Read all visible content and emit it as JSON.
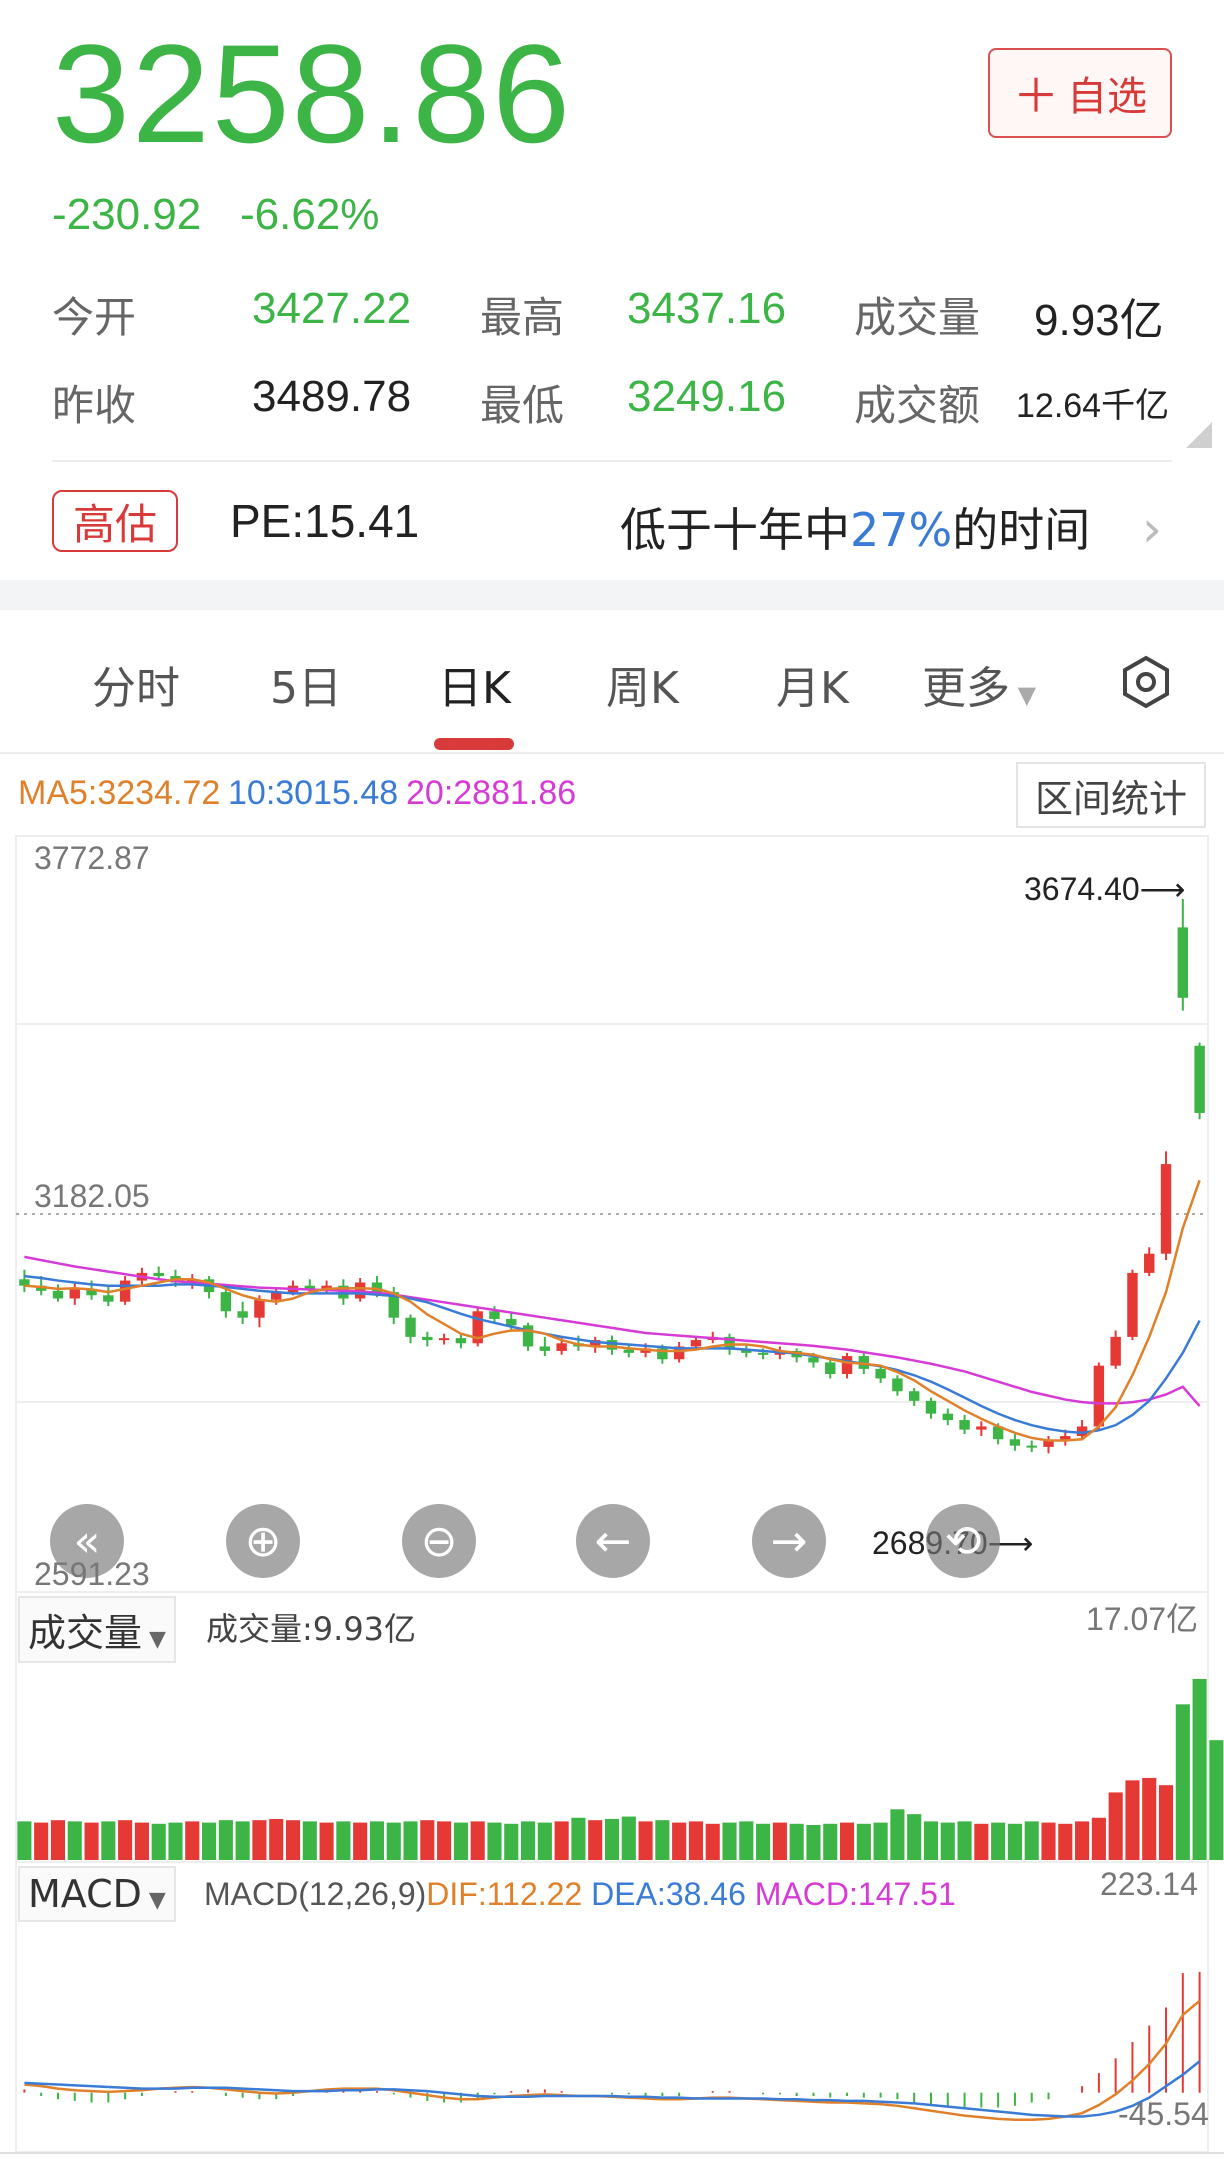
{
  "header": {
    "price": "3258.86",
    "change_abs": "-230.92",
    "change_pct": "-6.62%",
    "fav_button": "自选"
  },
  "quotes": {
    "open_label": "今开",
    "open_value": "3427.22",
    "high_label": "最高",
    "high_value": "3437.16",
    "volume_label": "成交量",
    "volume_value": "9.93亿",
    "prev_close_label": "昨收",
    "prev_close_value": "3489.78",
    "low_label": "最低",
    "low_value": "3249.16",
    "amount_label": "成交额",
    "amount_value": "12.64千亿"
  },
  "valuation": {
    "badge": "高估",
    "pe": "PE:15.41",
    "desc_prefix": "低于十年中",
    "desc_pct": "27%",
    "desc_suffix": "的时间"
  },
  "tabs": [
    {
      "label": "分时",
      "active": false
    },
    {
      "label": "5日",
      "active": false
    },
    {
      "label": "日K",
      "active": true
    },
    {
      "label": "周K",
      "active": false
    },
    {
      "label": "月K",
      "active": false
    },
    {
      "label": "更多",
      "active": false
    }
  ],
  "ma": {
    "ma5": "MA5:3234.72",
    "ma10": "10:3015.48",
    "ma20": "20:2881.86",
    "stat_button": "区间统计"
  },
  "colors": {
    "up": "#e53935",
    "down": "#3cb446",
    "ma5": "#e0802a",
    "ma10": "#3a7bd5",
    "ma20": "#d63bd6"
  },
  "kline": {
    "y_top": "3772.87",
    "y_mid": "3182.05",
    "y_bottom": "2591.23",
    "high_mark": "3674.40",
    "low_mark": "2689.70"
  },
  "volume": {
    "selector": "成交量",
    "label": "成交量:9.93亿",
    "max": "17.07亿"
  },
  "macd": {
    "selector": "MACD",
    "params": "MACD(12,26,9)",
    "dif": "DIF:112.22",
    "dea": "DEA:38.46",
    "macd": "MACD:147.51",
    "max": "223.14",
    "min": "-45.54"
  },
  "controls": [
    "fast-back-icon",
    "zoom-in-icon",
    "zoom-out-icon",
    "arrow-left-icon",
    "arrow-right-icon",
    "reset-icon"
  ],
  "chart_data": {
    "type": "candlestick",
    "ylim": [
      2591.23,
      3772.87
    ],
    "candles": [
      [
        3080,
        3070,
        3095,
        3060
      ],
      [
        3070,
        3062,
        3085,
        3055
      ],
      [
        3062,
        3050,
        3072,
        3045
      ],
      [
        3050,
        3065,
        3075,
        3040
      ],
      [
        3065,
        3055,
        3078,
        3048
      ],
      [
        3055,
        3045,
        3068,
        3038
      ],
      [
        3045,
        3078,
        3085,
        3040
      ],
      [
        3078,
        3090,
        3098,
        3070
      ],
      [
        3090,
        3085,
        3100,
        3078
      ],
      [
        3085,
        3075,
        3095,
        3068
      ],
      [
        3075,
        3080,
        3088,
        3065
      ],
      [
        3080,
        3060,
        3085,
        3050
      ],
      [
        3060,
        3030,
        3068,
        3020
      ],
      [
        3030,
        3020,
        3045,
        3010
      ],
      [
        3020,
        3048,
        3055,
        3005
      ],
      [
        3048,
        3060,
        3068,
        3040
      ],
      [
        3060,
        3070,
        3078,
        3055
      ],
      [
        3070,
        3065,
        3080,
        3058
      ],
      [
        3065,
        3070,
        3078,
        3058
      ],
      [
        3070,
        3050,
        3080,
        3040
      ],
      [
        3050,
        3075,
        3082,
        3045
      ],
      [
        3075,
        3060,
        3085,
        3052
      ],
      [
        3060,
        3020,
        3068,
        3010
      ],
      [
        3020,
        2990,
        3025,
        2980
      ],
      [
        2990,
        2985,
        2998,
        2975
      ],
      [
        2985,
        2988,
        2995,
        2978
      ],
      [
        2988,
        2980,
        2996,
        2972
      ],
      [
        2980,
        3030,
        3035,
        2975
      ],
      [
        3030,
        3018,
        3038,
        3010
      ],
      [
        3018,
        3008,
        3028,
        2998
      ],
      [
        3008,
        2975,
        3012,
        2968
      ],
      [
        2975,
        2968,
        2990,
        2960
      ],
      [
        2968,
        2980,
        2988,
        2962
      ],
      [
        2980,
        2975,
        2992,
        2968
      ],
      [
        2975,
        2985,
        2990,
        2965
      ],
      [
        2985,
        2970,
        2992,
        2962
      ],
      [
        2970,
        2965,
        2978,
        2958
      ],
      [
        2965,
        2972,
        2980,
        2958
      ],
      [
        2972,
        2955,
        2978,
        2948
      ],
      [
        2955,
        2975,
        2982,
        2950
      ],
      [
        2975,
        2985,
        2992,
        2970
      ],
      [
        2985,
        2990,
        2998,
        2980
      ],
      [
        2990,
        2970,
        2995,
        2962
      ],
      [
        2970,
        2965,
        2978,
        2958
      ],
      [
        2965,
        2962,
        2972,
        2955
      ],
      [
        2962,
        2968,
        2975,
        2955
      ],
      [
        2968,
        2958,
        2972,
        2950
      ],
      [
        2958,
        2950,
        2965,
        2942
      ],
      [
        2950,
        2932,
        2955,
        2925
      ],
      [
        2932,
        2960,
        2965,
        2925
      ],
      [
        2960,
        2940,
        2965,
        2932
      ],
      [
        2940,
        2925,
        2945,
        2918
      ],
      [
        2925,
        2905,
        2930,
        2898
      ],
      [
        2905,
        2890,
        2910,
        2882
      ],
      [
        2890,
        2870,
        2895,
        2862
      ],
      [
        2870,
        2860,
        2878,
        2852
      ],
      [
        2860,
        2845,
        2868,
        2838
      ],
      [
        2845,
        2850,
        2858,
        2835
      ],
      [
        2850,
        2830,
        2855,
        2822
      ],
      [
        2830,
        2820,
        2838,
        2812
      ],
      [
        2820,
        2818,
        2828,
        2810
      ],
      [
        2818,
        2828,
        2835,
        2808
      ],
      [
        2828,
        2835,
        2845,
        2820
      ],
      [
        2835,
        2850,
        2860,
        2828
      ],
      [
        2850,
        2945,
        2950,
        2845
      ],
      [
        2945,
        2990,
        3000,
        2940
      ],
      [
        2990,
        3090,
        3095,
        2985
      ],
      [
        3090,
        3120,
        3130,
        3085
      ],
      [
        3120,
        3260,
        3280,
        3110
      ],
      [
        3630,
        3520,
        3674.4,
        3500
      ],
      [
        3445,
        3340,
        3450,
        3330
      ]
    ],
    "ma5": [
      3070,
      3068,
      3065,
      3066,
      3064,
      3060,
      3065,
      3070,
      3075,
      3080,
      3080,
      3075,
      3065,
      3055,
      3048,
      3045,
      3050,
      3060,
      3065,
      3066,
      3066,
      3065,
      3058,
      3045,
      3025,
      3010,
      2995,
      2988,
      2995,
      3000,
      3000,
      2995,
      2985,
      2978,
      2975,
      2975,
      2972,
      2970,
      2968,
      2968,
      2970,
      2975,
      2978,
      2978,
      2975,
      2968,
      2965,
      2962,
      2955,
      2950,
      2948,
      2945,
      2935,
      2922,
      2905,
      2890,
      2875,
      2862,
      2850,
      2840,
      2832,
      2828,
      2828,
      2830,
      2850,
      2880,
      2930,
      2990,
      3060,
      3160,
      3234.72
    ],
    "ma10": [
      3085,
      3082,
      3078,
      3075,
      3072,
      3070,
      3070,
      3070,
      3070,
      3072,
      3072,
      3070,
      3068,
      3065,
      3062,
      3060,
      3058,
      3058,
      3058,
      3058,
      3058,
      3056,
      3054,
      3050,
      3044,
      3035,
      3026,
      3018,
      3012,
      3006,
      3000,
      2995,
      2990,
      2986,
      2982,
      2980,
      2978,
      2976,
      2974,
      2972,
      2972,
      2972,
      2972,
      2970,
      2968,
      2966,
      2964,
      2960,
      2956,
      2952,
      2948,
      2944,
      2938,
      2930,
      2920,
      2908,
      2895,
      2882,
      2870,
      2860,
      2852,
      2846,
      2842,
      2840,
      2844,
      2852,
      2868,
      2890,
      2925,
      2965,
      3015.48
    ],
    "ma20": [
      3115,
      3110,
      3105,
      3100,
      3096,
      3092,
      3088,
      3084,
      3080,
      3077,
      3075,
      3073,
      3071,
      3069,
      3067,
      3066,
      3065,
      3064,
      3063,
      3062,
      3061,
      3059,
      3056,
      3052,
      3048,
      3044,
      3040,
      3036,
      3032,
      3028,
      3024,
      3020,
      3016,
      3012,
      3008,
      3004,
      3000,
      2996,
      2994,
      2992,
      2990,
      2988,
      2986,
      2984,
      2982,
      2980,
      2978,
      2976,
      2973,
      2970,
      2966,
      2962,
      2958,
      2953,
      2948,
      2942,
      2936,
      2928,
      2920,
      2912,
      2904,
      2898,
      2892,
      2888,
      2886,
      2886,
      2888,
      2892,
      2900,
      2912,
      2881.86
    ],
    "volume_max": 17.07,
    "volume": [
      3.2,
      3.1,
      3.3,
      3.2,
      3.1,
      3.2,
      3.3,
      3.1,
      3.0,
      3.1,
      3.2,
      3.1,
      3.3,
      3.2,
      3.3,
      3.4,
      3.3,
      3.2,
      3.1,
      3.2,
      3.1,
      3.2,
      3.1,
      3.2,
      3.3,
      3.2,
      3.1,
      3.2,
      3.1,
      3.0,
      3.2,
      3.1,
      3.2,
      3.5,
      3.3,
      3.4,
      3.6,
      3.2,
      3.3,
      3.1,
      3.2,
      3.0,
      3.1,
      3.2,
      3.0,
      3.1,
      3.0,
      2.9,
      3.0,
      3.1,
      3.0,
      3.1,
      4.2,
      3.8,
      3.2,
      3.1,
      3.2,
      3.0,
      3.1,
      3.0,
      3.2,
      3.1,
      3.0,
      3.2,
      3.5,
      5.6,
      6.6,
      6.8,
      6.2,
      12.9,
      15.0,
      9.93
    ],
    "volume_up": [
      0,
      1,
      1,
      0,
      1,
      0,
      1,
      1,
      0,
      0,
      1,
      0,
      0,
      0,
      1,
      1,
      1,
      0,
      1,
      0,
      1,
      0,
      0,
      0,
      1,
      1,
      0,
      1,
      0,
      0,
      0,
      0,
      1,
      0,
      1,
      0,
      0,
      1,
      0,
      1,
      1,
      1,
      0,
      0,
      0,
      1,
      0,
      0,
      0,
      1,
      0,
      0,
      0,
      0,
      0,
      0,
      0,
      1,
      0,
      0,
      0,
      1,
      1,
      1,
      1,
      1,
      1,
      1,
      1,
      0,
      0
    ],
    "dif": [
      10,
      8,
      5,
      3,
      2,
      1,
      2,
      3,
      5,
      6,
      7,
      6,
      4,
      2,
      0,
      -1,
      0,
      2,
      4,
      5,
      5,
      5,
      3,
      0,
      -3,
      -6,
      -8,
      -8,
      -6,
      -4,
      -3,
      -2,
      -3,
      -4,
      -4,
      -5,
      -6,
      -7,
      -8,
      -8,
      -7,
      -6,
      -6,
      -7,
      -8,
      -9,
      -10,
      -11,
      -12,
      -12,
      -13,
      -14,
      -16,
      -19,
      -22,
      -25,
      -28,
      -30,
      -32,
      -33,
      -33,
      -32,
      -29,
      -25,
      -15,
      -2,
      15,
      35,
      60,
      95,
      112.22
    ],
    "dea": [
      12,
      11,
      10,
      9,
      8,
      7,
      6,
      5,
      5,
      5,
      6,
      6,
      6,
      5,
      4,
      3,
      2,
      2,
      2,
      3,
      3,
      4,
      4,
      3,
      2,
      0,
      -2,
      -4,
      -5,
      -5,
      -5,
      -4,
      -4,
      -4,
      -4,
      -4,
      -5,
      -5,
      -6,
      -6,
      -7,
      -7,
      -7,
      -7,
      -7,
      -8,
      -8,
      -9,
      -9,
      -10,
      -10,
      -11,
      -12,
      -13,
      -15,
      -17,
      -19,
      -21,
      -23,
      -25,
      -27,
      -28,
      -29,
      -29,
      -27,
      -23,
      -16,
      -6,
      8,
      22,
      38.46
    ],
    "macd_hist": [
      4,
      -4,
      -8,
      -10,
      -12,
      -12,
      -8,
      -4,
      0,
      2,
      2,
      0,
      -4,
      -6,
      -8,
      -8,
      -4,
      0,
      4,
      4,
      4,
      2,
      -2,
      -6,
      -10,
      -12,
      -12,
      -8,
      -2,
      2,
      4,
      4,
      2,
      0,
      0,
      -2,
      -2,
      -4,
      -4,
      -4,
      0,
      2,
      2,
      0,
      -2,
      -2,
      -4,
      -4,
      -6,
      -4,
      -6,
      -6,
      -8,
      -12,
      -14,
      -16,
      -18,
      -18,
      -18,
      -16,
      -12,
      -8,
      0,
      8,
      24,
      42,
      62,
      82,
      104,
      146,
      147.51
    ],
    "macd_range": [
      -45.54,
      223.14
    ]
  }
}
